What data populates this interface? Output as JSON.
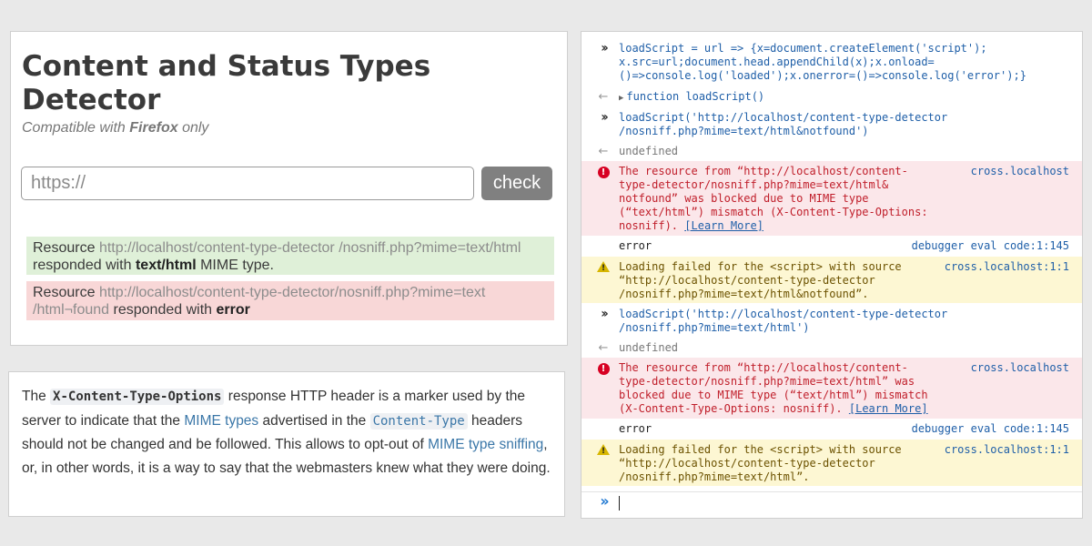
{
  "detector": {
    "title": "Content and Status Types Detector",
    "subtitle_prefix": "Compatible with",
    "subtitle_browser": "Firefox",
    "subtitle_suffix": "only",
    "url_placeholder": "https://",
    "check_label": "check",
    "results": [
      {
        "status": "success",
        "prefix": "Resource",
        "url": "http://localhost/content-type-detector /nosniff.php?mime=text/html",
        "middle": "responded with",
        "type": "text/html",
        "suffix": "MIME type."
      },
      {
        "status": "error",
        "prefix": "Resource",
        "url": "http://localhost/content-type-detector/nosniff.php?mime=text /html¬found",
        "middle": "responded with",
        "type": "error"
      }
    ]
  },
  "description": {
    "p1": "The",
    "code1": "X-Content-Type-Options",
    "p2": "response HTTP header is a marker used by the server to indicate that the",
    "link1": "MIME types",
    "p3": "advertised in the",
    "code2": "Content-Type",
    "p4": "headers should not be changed and be followed. This allows to opt-out of",
    "link2": "MIME type sniffing",
    "p5": ", or, in other words, it is a way to say that the webmasters knew what they were doing."
  },
  "console": {
    "entries": [
      {
        "kind": "input",
        "lines": [
          "loadScript = url => {x=document.createElement('script');",
          "x.src=url;document.head.appendChild(x);x.onload=",
          "()=>console.log('loaded');x.onerror=()=>console.log('error');}"
        ]
      },
      {
        "kind": "return",
        "text": "function loadScript()"
      },
      {
        "kind": "input",
        "lines": [
          "loadScript('http://localhost/content-type-detector",
          "/nosniff.php?mime=text/html&notfound')"
        ]
      },
      {
        "kind": "return",
        "text": "undefined"
      },
      {
        "kind": "error",
        "lines": [
          "The resource from “http://localhost/content-",
          "type-detector/nosniff.php?mime=text/html&",
          "notfound” was blocked due to MIME type",
          "(“text/html”) mismatch (X-Content-Type-Options:",
          "nosniff)."
        ],
        "link": "[Learn More]",
        "source": "cross.localhost"
      },
      {
        "kind": "log",
        "text": "error",
        "source": "debugger eval code:1:145"
      },
      {
        "kind": "warning",
        "lines": [
          "Loading failed for the <script> with source",
          "“http://localhost/content-type-detector",
          "/nosniff.php?mime=text/html&notfound”."
        ],
        "source": "cross.localhost:1:1"
      },
      {
        "kind": "input",
        "lines": [
          "loadScript('http://localhost/content-type-detector",
          "/nosniff.php?mime=text/html')"
        ]
      },
      {
        "kind": "return",
        "text": "undefined"
      },
      {
        "kind": "error",
        "lines": [
          "The resource from “http://localhost/content-",
          "type-detector/nosniff.php?mime=text/html” was",
          "blocked due to MIME type (“text/html”) mismatch",
          "(X-Content-Type-Options: nosniff)."
        ],
        "link": "[Learn More]",
        "source": "cross.localhost"
      },
      {
        "kind": "log",
        "text": "error",
        "source": "debugger eval code:1:145"
      },
      {
        "kind": "warning",
        "lines": [
          "Loading failed for the <script> with source",
          "“http://localhost/content-type-detector",
          "/nosniff.php?mime=text/html”."
        ],
        "source": "cross.localhost:1:1"
      }
    ]
  },
  "colors": {
    "success_bg": "#dff0d8",
    "error_bg": "#f8d7d7",
    "console_error": "#c01e2a",
    "console_link": "#1f5fa8"
  }
}
